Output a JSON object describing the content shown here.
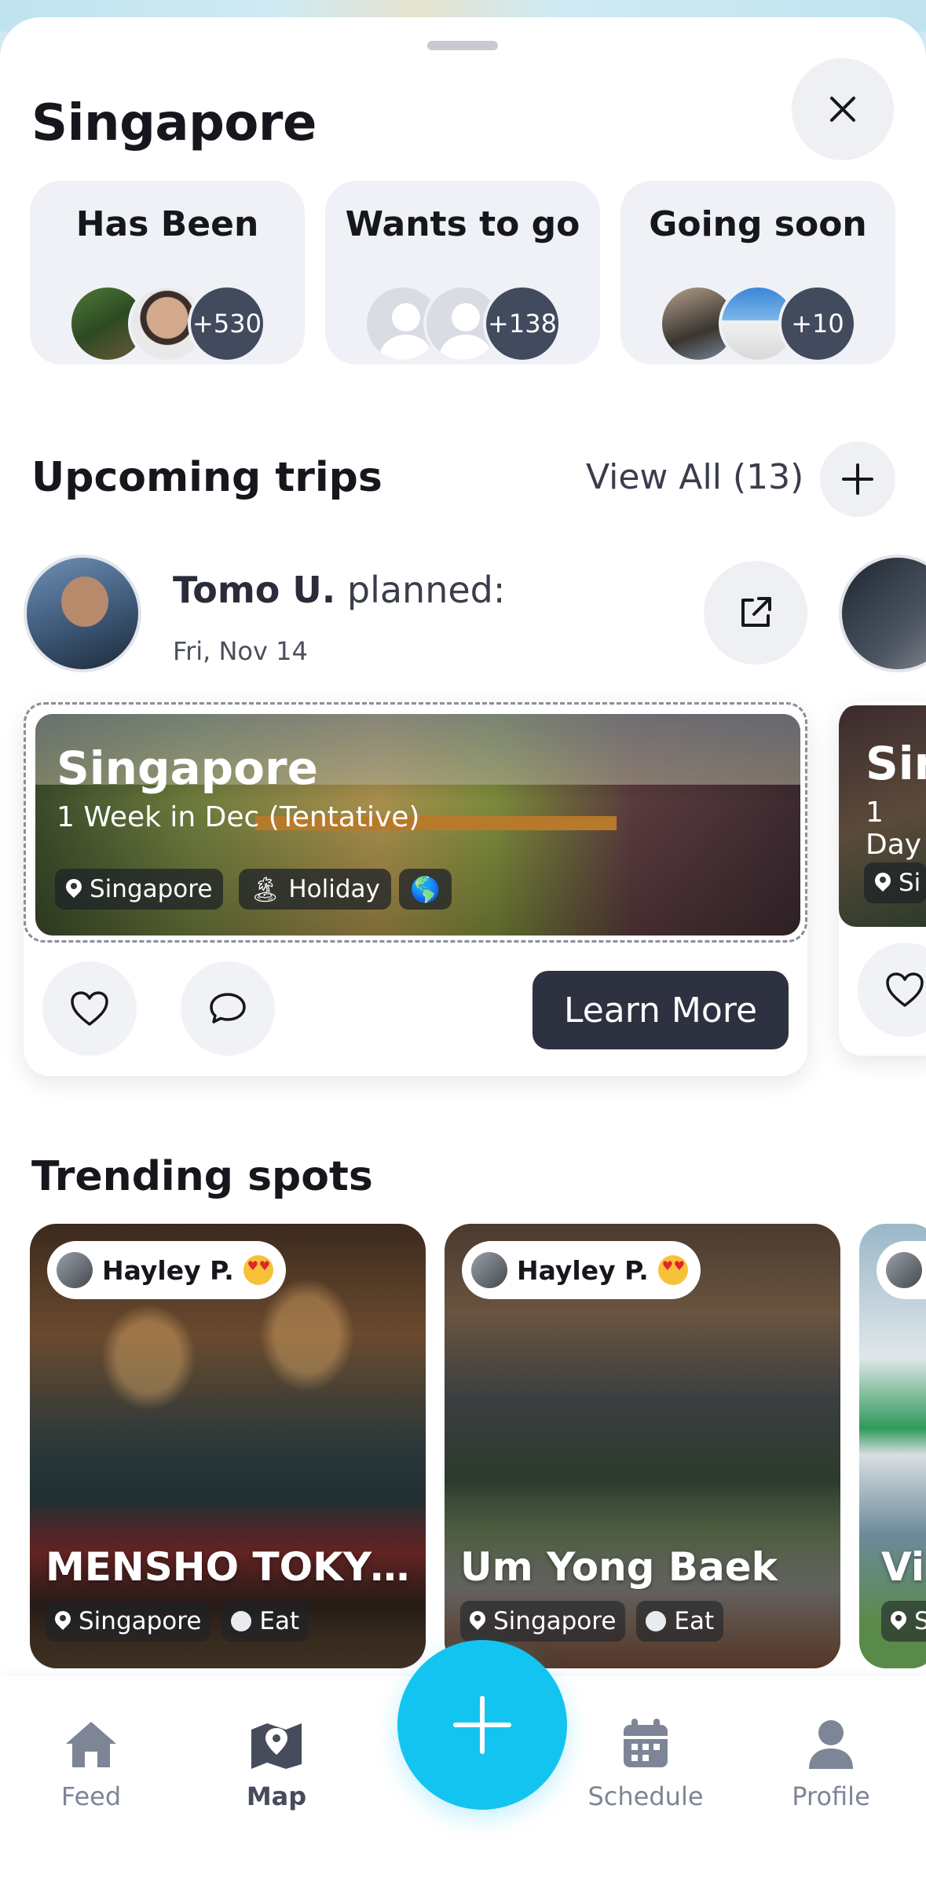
{
  "sheet": {
    "title": "Singapore"
  },
  "status": [
    {
      "label": "Has Been",
      "count": "+530"
    },
    {
      "label": "Wants to go",
      "count": "+138"
    },
    {
      "label": "Going soon",
      "count": "+10"
    }
  ],
  "upcoming": {
    "title": "Upcoming trips",
    "view_all": "View All (13)",
    "planner_name": "Tomo U.",
    "planner_action": "planned:",
    "date": "Fri, Nov 14",
    "trip": {
      "title": "Singapore",
      "subtitle": "1 Week in Dec (Tentative)",
      "chips": {
        "location": "Singapore",
        "tag": "Holiday",
        "globe": "🌎",
        "tag_emoji": "🏝"
      }
    },
    "learn_more": "Learn More",
    "peek": {
      "title": "Sin",
      "subtitle": "1 Day",
      "chip": "Si"
    }
  },
  "trending": {
    "title": "Trending spots",
    "spots": [
      {
        "user": "Hayley P.",
        "name": "MENSHO TOKYO...",
        "location": "Singapore",
        "category": "Eat"
      },
      {
        "user": "Hayley P.",
        "name": "Um Yong Baek",
        "location": "Singapore",
        "category": "Eat"
      },
      {
        "user": "",
        "name": "Vi",
        "location": "S",
        "category": ""
      }
    ]
  },
  "nav": {
    "feed": "Feed",
    "map": "Map",
    "schedule": "Schedule",
    "profile": "Profile"
  },
  "colors": {
    "accent": "#14c4f0",
    "dark_button": "#2d3140",
    "count_badge": "#424a5e"
  }
}
